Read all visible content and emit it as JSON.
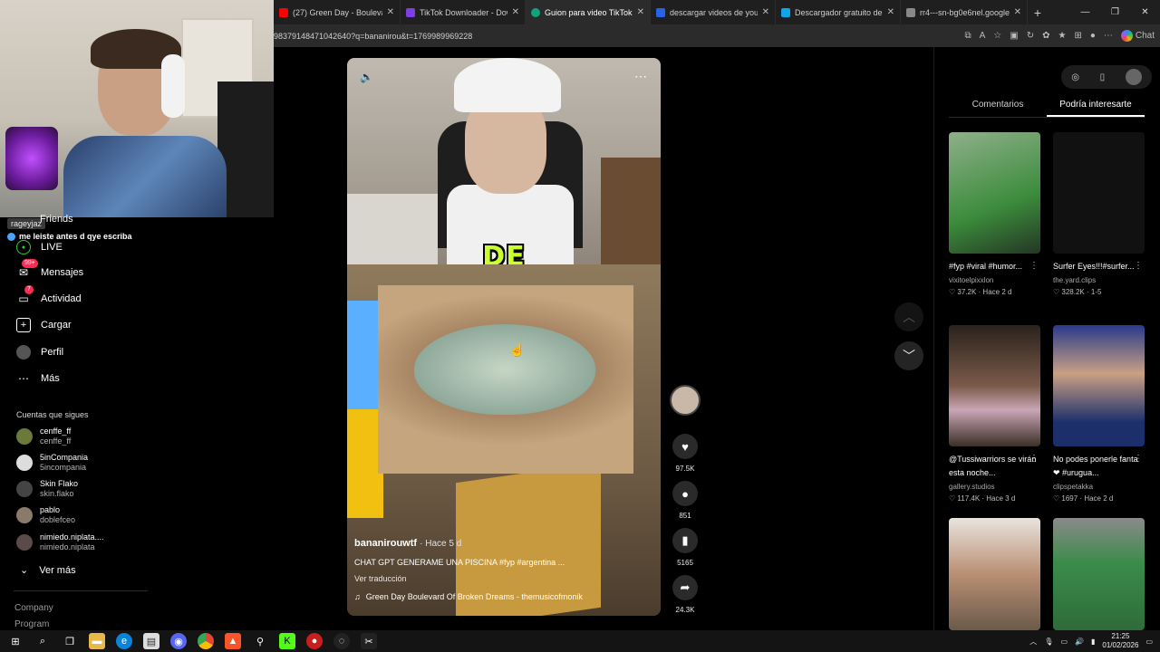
{
  "browser": {
    "tabs": [
      {
        "label": "(27) Green Day - Boulevard o",
        "color": "#ff0000"
      },
      {
        "label": "TikTok Downloader - Downlo",
        "color": "#7b3fe4"
      },
      {
        "label": "Guion para video TikTok",
        "color": "#10a37f"
      },
      {
        "label": "descargar videos de youtub",
        "color": "#2563eb"
      },
      {
        "label": "Descargador gratuito de vid",
        "color": "#0ea5e9"
      },
      {
        "label": "rr4---sn-bg0e6nel.googlevid",
        "color": "#888888"
      }
    ],
    "url": "98379148471042640?q=bananirou&t=1769989969228",
    "chat_label": "Chat"
  },
  "stream": {
    "chat_user": "rageyjaz",
    "chat_message": "me leiste antes d qye escriba"
  },
  "sidebar": {
    "items": [
      {
        "label": "Friends",
        "icon": "friends-icon"
      },
      {
        "label": "LIVE",
        "icon": "live-icon"
      },
      {
        "label": "Mensajes",
        "icon": "message-icon",
        "badge": "99+"
      },
      {
        "label": "Actividad",
        "icon": "activity-icon",
        "badge": "7"
      },
      {
        "label": "Cargar",
        "icon": "upload-icon"
      },
      {
        "label": "Perfil",
        "icon": "profile-icon"
      },
      {
        "label": "Más",
        "icon": "more-icon"
      }
    ],
    "following_title": "Cuentas que sigues",
    "following": [
      {
        "name": "cenffe_ff",
        "handle": "cenffe_ff",
        "color": "#6b7a3a"
      },
      {
        "name": "5inCompania",
        "handle": "5incompania",
        "color": "#dddddd"
      },
      {
        "name": "Skin Flako",
        "handle": "skin.flako",
        "color": "#444444"
      },
      {
        "name": "pablo",
        "handle": "doblefceo",
        "color": "#8a7a6a"
      },
      {
        "name": "nimiedo.niplata....",
        "handle": "nimiedo.niplata",
        "color": "#5a4a4a"
      }
    ],
    "see_more": "Ver más",
    "company": "Company",
    "program": "Program"
  },
  "video": {
    "caption": "DE",
    "author": "bananirouwtf",
    "ago": "· Hace 5 d",
    "description": "CHAT GPT GENERAME UNA PISCINA #fyp #argentina ...",
    "translate": "Ver traducción",
    "music": "Green Day Boulevard Of Broken Dreams - themusicofmonik",
    "likes": "97.5K",
    "comments": "851",
    "saves": "5165",
    "shares": "24.3K"
  },
  "panel": {
    "tabs": [
      "Comentarios",
      "Podría interesarte"
    ],
    "cards": [
      {
        "title": "#fyp #viral #humor...",
        "author": "vixitoelpixxlon",
        "likes": "37.2K",
        "time": "Hace 2 d",
        "bg": "#3c8c3c"
      },
      {
        "title": "Surfer Eyes!!!#surfer...",
        "author": "the.yard.clips",
        "likes": "328.2K",
        "time": "1-5",
        "bg": "#111111"
      },
      {
        "title": "@Tussiwarriors se virán esta noche...",
        "author": "gallery.studios",
        "likes": "117.4K",
        "time": "Hace 3 d",
        "bg": "#3a2e26"
      },
      {
        "title": "No podes ponerle fanta❤ #urugua...",
        "author": "clipspetakka",
        "likes": "1697",
        "time": "Hace 2 d",
        "bg": "#1d2f6b"
      },
      {
        "title": "",
        "author": "",
        "likes": "",
        "time": "",
        "bg": "#6b5a4a"
      },
      {
        "title": "",
        "author": "",
        "likes": "",
        "time": "",
        "bg": "#2e6b3a"
      }
    ]
  },
  "taskbar": {
    "time": "21:25",
    "date": "01/02/2026"
  }
}
